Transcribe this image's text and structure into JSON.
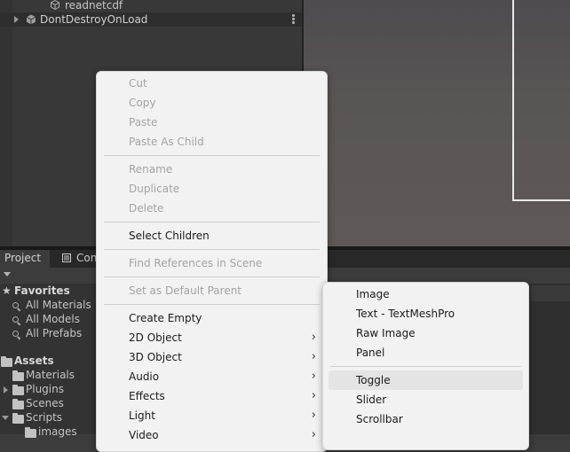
{
  "hierarchy": {
    "rows": [
      {
        "label": "readnetcdf"
      },
      {
        "label": "DontDestroyOnLoad"
      }
    ]
  },
  "project_panel": {
    "tabs": [
      {
        "label": "Project"
      },
      {
        "label": "Con"
      }
    ],
    "favorites": {
      "title": "Favorites",
      "items": [
        "All Materials",
        "All Models",
        "All Prefabs"
      ]
    },
    "assets": {
      "title": "Assets",
      "items": [
        "Materials",
        "Plugins",
        "Scenes",
        "Scripts",
        "images"
      ]
    }
  },
  "context_menu": {
    "items": [
      {
        "label": "Cut",
        "enabled": false
      },
      {
        "label": "Copy",
        "enabled": false
      },
      {
        "label": "Paste",
        "enabled": false
      },
      {
        "label": "Paste As Child",
        "enabled": false
      },
      {
        "label": "Rename",
        "enabled": false
      },
      {
        "label": "Duplicate",
        "enabled": false
      },
      {
        "label": "Delete",
        "enabled": false
      },
      {
        "label": "Select Children",
        "enabled": true
      },
      {
        "label": "Find References in Scene",
        "enabled": false
      },
      {
        "label": "Set as Default Parent",
        "enabled": false
      },
      {
        "label": "Create Empty",
        "enabled": true
      },
      {
        "label": "2D Object",
        "enabled": true,
        "submenu": true
      },
      {
        "label": "3D Object",
        "enabled": true,
        "submenu": true
      },
      {
        "label": "Audio",
        "enabled": true,
        "submenu": true
      },
      {
        "label": "Effects",
        "enabled": true,
        "submenu": true
      },
      {
        "label": "Light",
        "enabled": true,
        "submenu": true
      },
      {
        "label": "Video",
        "enabled": true,
        "submenu": true
      }
    ]
  },
  "ui_submenu": {
    "items": [
      {
        "label": "Image"
      },
      {
        "label": "Text - TextMeshPro"
      },
      {
        "label": "Raw Image"
      },
      {
        "label": "Panel"
      },
      {
        "label": "Toggle",
        "highlighted": true
      },
      {
        "label": "Slider"
      },
      {
        "label": "Scrollbar"
      }
    ]
  },
  "colors": {
    "menu_bg": "#f2f2f2",
    "menu_text": "#1b1b1b",
    "menu_disabled": "#a3a3a3",
    "editor_bg": "#383838"
  }
}
